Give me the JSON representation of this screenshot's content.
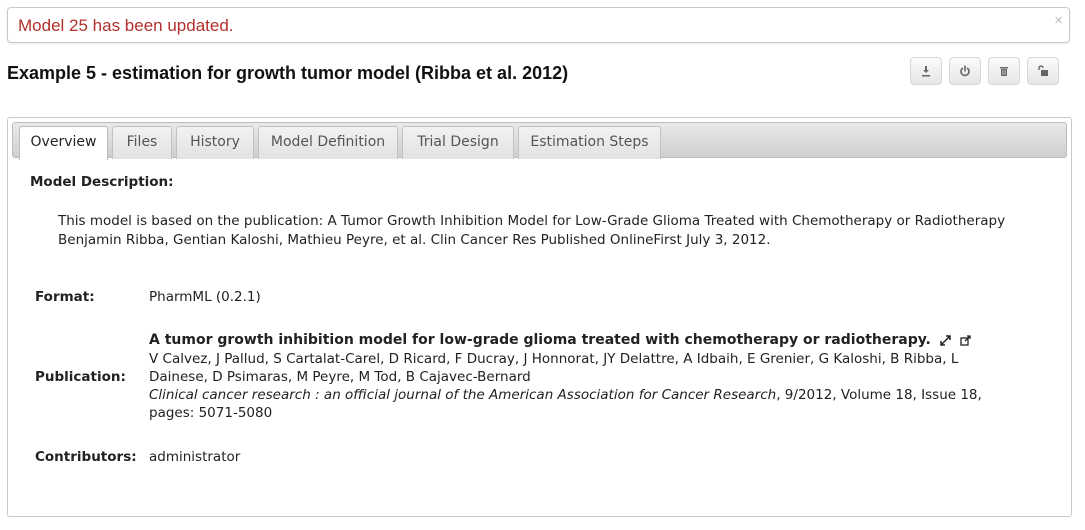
{
  "alert": {
    "message": "Model 25 has been updated.",
    "close": "×"
  },
  "title": "Example 5 - estimation for growth tumor model (Ribba et al. 2012)",
  "toolbar": {
    "buttons": [
      {
        "icon": "download-icon"
      },
      {
        "icon": "share-icon"
      },
      {
        "icon": "trash-icon"
      },
      {
        "icon": "unlock-icon"
      }
    ]
  },
  "tabs": [
    {
      "label": "Overview",
      "active": true
    },
    {
      "label": "Files"
    },
    {
      "label": "History"
    },
    {
      "label": "Model Definition"
    },
    {
      "label": "Trial Design"
    },
    {
      "label": "Estimation Steps"
    }
  ],
  "overview": {
    "description_heading": "Model Description:",
    "description_line1": "This model is based on the publication: A Tumor Growth Inhibition Model for Low-Grade Glioma Treated with Chemotherapy or Radiotherapy",
    "description_line2": "Benjamin Ribba, Gentian Kaloshi, Mathieu Peyre, et al. Clin Cancer Res Published OnlineFirst July 3, 2012.",
    "format_label": "Format:",
    "format_value": "PharmML (0.2.1)",
    "publication_label": "Publication:",
    "publication": {
      "title": "A tumor growth inhibition model for low-grade glioma treated with chemotherapy or radiotherapy.",
      "authors_line1": "V Calvez, J Pallud, S Cartalat-Carel, D Ricard, F Ducray, J Honnorat, JY Delattre, A Idbaih, E Grenier, G Kaloshi, B Ribba, L",
      "authors_line2": "Dainese, D Psimaras, M Peyre, M Tod, B Cajavec-Bernard",
      "journal": "Clinical cancer research : an official journal of the American Association for Cancer Research",
      "journal_details": ", 9/2012, Volume 18, Issue 18,",
      "pages": "pages: 5071-5080"
    },
    "contributors_label": "Contributors:",
    "contributors_value": "administrator"
  }
}
